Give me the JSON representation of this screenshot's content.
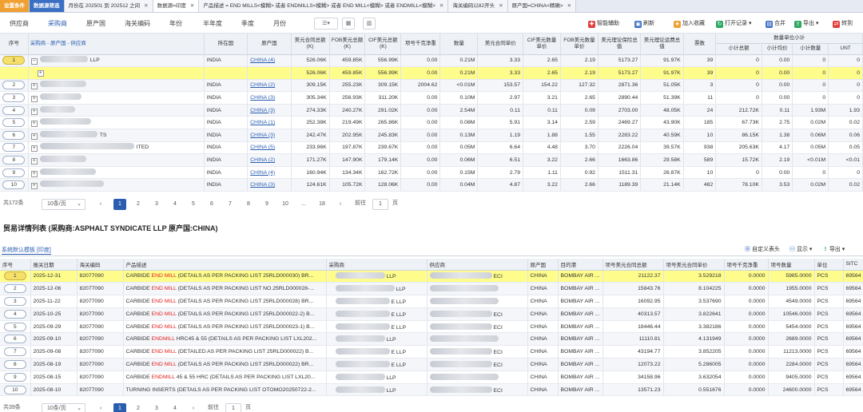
{
  "filter_tabs": [
    {
      "label": "设置条件",
      "style": "orange",
      "closable": false
    },
    {
      "label": "数据源筛选",
      "style": "blue",
      "closable": false
    },
    {
      "label": "月份在 202501 到 202512 之间",
      "style": "",
      "closable": true
    },
    {
      "label": "数据源=印度",
      "style": "active",
      "closable": true
    },
    {
      "label": "产品描述 = END MILLS<模糊> 或者 ENDMILLS<模糊> 或者 END MILL<模糊> 或者 ENDMILL<模糊>",
      "style": "",
      "closable": true
    },
    {
      "label": "海关编码以82开头",
      "style": "",
      "closable": true
    },
    {
      "label": "原产国=CHINA<精确>",
      "style": "",
      "closable": true
    }
  ],
  "dimension_tabs": [
    "供应商",
    "采购商",
    "原产国",
    "海关编码",
    "年份",
    "半年度",
    "季度",
    "月份"
  ],
  "toolbar": {
    "smart_assist": "智能辅助",
    "refresh": "刷新",
    "add_favorite": "加入收藏",
    "open_record": "打开记录",
    "merge": "合并",
    "export": "导出",
    "convert": "转到"
  },
  "summary_table": {
    "headers": {
      "seq": "序号",
      "buyer": "采购商 - 原产国 - 供应商",
      "country": "所在国",
      "origin": "原产国",
      "usd_total": "美元合同总额(K)",
      "fob_total": "FOB美元总额(K)",
      "cif_total": "CIF美元总额(K)",
      "net_weight": "项号千克净重",
      "qty": "数量",
      "usd_unit": "美元合同单价",
      "cif_unit": "CIF美元数量单价",
      "fob_unit": "FOB美元数量单价",
      "theory_unit": "美元理论保险总值",
      "theory_total": "美元理论运费总值",
      "count": "票数",
      "group_unit": "数量单位小计",
      "sub_amount": "小计总额",
      "sub_unit_price": "小计均价",
      "sub_qty": "小计数量",
      "unt": "UNT"
    },
    "rows": [
      {
        "seq": "1",
        "buyer_tail": "LLP",
        "country": "INDIA",
        "origin": "CHINA (4)",
        "usd_total": "526.06K",
        "fob_total": "459.85K",
        "cif_total": "556.99K",
        "net_weight": "0.00",
        "qty": "0.21M",
        "usd_unit": "3.33",
        "cif_unit": "2.65",
        "fob_unit": "2.19",
        "theory_unit": "5173.27",
        "theory_total": "91.97K",
        "count": "39",
        "sub_amount": "0",
        "sub_unit_price": "0.00",
        "sub_qty": "0",
        "unt": "0",
        "type": "parent"
      },
      {
        "seq": "",
        "buyer_tail": "",
        "country": "",
        "origin": "",
        "usd_total": "526.06K",
        "fob_total": "459.85K",
        "cif_total": "556.99K",
        "net_weight": "0.00",
        "qty": "0.21M",
        "usd_unit": "3.33",
        "cif_unit": "2.65",
        "fob_unit": "2.19",
        "theory_unit": "5173.27",
        "theory_total": "91.97K",
        "count": "39",
        "sub_amount": "0",
        "sub_unit_price": "0.00",
        "sub_qty": "0",
        "unt": "0",
        "type": "highlight"
      },
      {
        "seq": "2",
        "buyer_tail": "",
        "country": "INDIA",
        "origin": "CHINA (2)",
        "usd_total": "309.15K",
        "fob_total": "255.23K",
        "cif_total": "309.15K",
        "net_weight": "2004.62",
        "qty": "<0.01M",
        "usd_unit": "153.57",
        "cif_unit": "154.22",
        "fob_unit": "127.32",
        "theory_unit": "2871.36",
        "theory_total": "51.05K",
        "count": "3",
        "sub_amount": "0",
        "sub_unit_price": "0.00",
        "sub_qty": "0",
        "unt": "0",
        "type": "row"
      },
      {
        "seq": "3",
        "buyer_tail": "",
        "country": "INDIA",
        "origin": "CHINA (3)",
        "usd_total": "305.34K",
        "fob_total": "256.93K",
        "cif_total": "311.20K",
        "net_weight": "0.00",
        "qty": "0.10M",
        "usd_unit": "2.97",
        "cif_unit": "3.21",
        "fob_unit": "2.65",
        "theory_unit": "2890.44",
        "theory_total": "51.39K",
        "count": "11",
        "sub_amount": "0",
        "sub_unit_price": "0.00",
        "sub_qty": "0",
        "unt": "0",
        "type": "row"
      },
      {
        "seq": "4",
        "buyer_tail": "",
        "country": "INDIA",
        "origin": "CHINA (3)",
        "usd_total": "274.33K",
        "fob_total": "240.27K",
        "cif_total": "291.02K",
        "net_weight": "0.00",
        "qty": "2.54M",
        "usd_unit": "0.11",
        "cif_unit": "0.11",
        "fob_unit": "0.09",
        "theory_unit": "2703.00",
        "theory_total": "48.05K",
        "count": "24",
        "sub_amount": "212.72K",
        "sub_unit_price": "0.11",
        "sub_qty": "1.93M",
        "unt": "1.93",
        "type": "row"
      },
      {
        "seq": "5",
        "buyer_tail": "",
        "country": "INDIA",
        "origin": "CHINA (1)",
        "usd_total": "252.38K",
        "fob_total": "219.49K",
        "cif_total": "265.86K",
        "net_weight": "0.00",
        "qty": "0.08M",
        "usd_unit": "5.91",
        "cif_unit": "3.14",
        "fob_unit": "2.59",
        "theory_unit": "2469.27",
        "theory_total": "43.90K",
        "count": "185",
        "sub_amount": "67.73K",
        "sub_unit_price": "2.75",
        "sub_qty": "0.02M",
        "unt": "0.02",
        "type": "row"
      },
      {
        "seq": "6",
        "buyer_tail": "TS",
        "country": "INDIA",
        "origin": "CHINA (3)",
        "usd_total": "242.47K",
        "fob_total": "202.95K",
        "cif_total": "245.83K",
        "net_weight": "0.00",
        "qty": "0.13M",
        "usd_unit": "1.19",
        "cif_unit": "1.88",
        "fob_unit": "1.55",
        "theory_unit": "2283.22",
        "theory_total": "40.59K",
        "count": "10",
        "sub_amount": "86.15K",
        "sub_unit_price": "1.38",
        "sub_qty": "0.06M",
        "unt": "0.06",
        "type": "row"
      },
      {
        "seq": "7",
        "buyer_tail": "ITED",
        "country": "INDIA",
        "origin": "CHINA (5)",
        "usd_total": "233.96K",
        "fob_total": "197.87K",
        "cif_total": "239.67K",
        "net_weight": "0.00",
        "qty": "0.05M",
        "usd_unit": "6.64",
        "cif_unit": "4.48",
        "fob_unit": "3.70",
        "theory_unit": "2226.04",
        "theory_total": "39.57K",
        "count": "938",
        "sub_amount": "205.63K",
        "sub_unit_price": "4.17",
        "sub_qty": "0.05M",
        "unt": "0.05",
        "type": "row"
      },
      {
        "seq": "8",
        "buyer_tail": "",
        "country": "INDIA",
        "origin": "CHINA (2)",
        "usd_total": "171.27K",
        "fob_total": "147.90K",
        "cif_total": "179.14K",
        "net_weight": "0.00",
        "qty": "0.06M",
        "usd_unit": "6.51",
        "cif_unit": "3.22",
        "fob_unit": "2.66",
        "theory_unit": "1663.86",
        "theory_total": "29.58K",
        "count": "589",
        "sub_amount": "15.72K",
        "sub_unit_price": "2.19",
        "sub_qty": "<0.01M",
        "unt": "<0.01",
        "type": "row"
      },
      {
        "seq": "9",
        "buyer_tail": "",
        "country": "INDIA",
        "origin": "CHINA (4)",
        "usd_total": "160.94K",
        "fob_total": "134.34K",
        "cif_total": "162.72K",
        "net_weight": "0.00",
        "qty": "0.15M",
        "usd_unit": "2.79",
        "cif_unit": "1.11",
        "fob_unit": "0.92",
        "theory_unit": "1511.31",
        "theory_total": "26.87K",
        "count": "10",
        "sub_amount": "0",
        "sub_unit_price": "0.00",
        "sub_qty": "0",
        "unt": "0",
        "type": "row"
      },
      {
        "seq": "10",
        "buyer_tail": "",
        "country": "INDIA",
        "origin": "CHINA (3)",
        "usd_total": "124.61K",
        "fob_total": "105.72K",
        "cif_total": "128.06K",
        "net_weight": "0.00",
        "qty": "0.04M",
        "usd_unit": "4.87",
        "cif_unit": "3.22",
        "fob_unit": "2.66",
        "theory_unit": "1189.39",
        "theory_total": "21.14K",
        "count": "482",
        "sub_amount": "78.10K",
        "sub_unit_price": "3.53",
        "sub_qty": "0.02M",
        "unt": "0.02",
        "type": "row"
      }
    ]
  },
  "pager_top": {
    "total": "共172条",
    "page_size": "10条/页",
    "pages": [
      "1",
      "2",
      "3",
      "4",
      "5",
      "6",
      "7",
      "8",
      "9",
      "10",
      "...",
      "18"
    ],
    "current": "1",
    "goto_label": "前往",
    "goto_value": "1",
    "page_unit": "页"
  },
  "detail": {
    "title": "贸易详情列表 (采购商:ASPHALT SYNDICATE LLP 原产国:CHINA)",
    "template_label": "系统默认模板 [印度]",
    "custom_header": "自定义表头",
    "display": "显示",
    "export": "导出",
    "headers": {
      "seq": "序号",
      "date": "报关日期",
      "hs": "海关编码",
      "desc": "产品描述",
      "buyer": "采购商",
      "supplier": "供应商",
      "origin": "原产国",
      "dest": "目的港",
      "usd_total": "项号美元合同总额",
      "usd_unit": "项号美元合同单价",
      "net_weight": "项号千克净重",
      "qty": "项号数量",
      "unit": "单位",
      "sitc": "SITC"
    },
    "rows": [
      {
        "seq": "1",
        "date": "2025-12-31",
        "hs": "82077090",
        "desc_pre": "CARBIDE ",
        "desc_hl": "END MILL",
        "desc_post": " (DETAILS AS PER PACKING LIST 25RLD000030) BR...",
        "buyer_tail": "LLP",
        "supplier_tail": "ECI",
        "origin": "CHINA",
        "dest": "BOMBAY AIR ...",
        "usd_total": "21122.37",
        "usd_unit": "3.529218",
        "net_weight": "0.0000",
        "qty": "5985.0000",
        "unit": "PCS",
        "sitc": "69564"
      },
      {
        "seq": "2",
        "date": "2025-12-06",
        "hs": "82077090",
        "desc_pre": "CARBIDE ",
        "desc_hl": "END MILL",
        "desc_post": " (DETAILS AS PER PACKING LIST NO.25RLD000028-...",
        "buyer_tail": "LLP",
        "supplier_tail": "",
        "origin": "CHINA",
        "dest": "BOMBAY AIR ...",
        "usd_total": "15843.76",
        "usd_unit": "8.104225",
        "net_weight": "0.0000",
        "qty": "1955.0000",
        "unit": "PCS",
        "sitc": "69564"
      },
      {
        "seq": "3",
        "date": "2025-11-22",
        "hs": "82077090",
        "desc_pre": "CARBIDE ",
        "desc_hl": "END MILL",
        "desc_post": " (DETAILS AS PER PACKING LIST 25RLD000028) BR...",
        "buyer_tail": "E LLP",
        "supplier_tail": "",
        "origin": "CHINA",
        "dest": "BOMBAY AIR ...",
        "usd_total": "16092.95",
        "usd_unit": "3.537690",
        "net_weight": "0.0000",
        "qty": "4549.0000",
        "unit": "PCS",
        "sitc": "69564"
      },
      {
        "seq": "4",
        "date": "2025-10-25",
        "hs": "82077090",
        "desc_pre": "CARBIDE ",
        "desc_hl": "END MILL",
        "desc_post": " (DETAILS AS PER PACKING LIST 25RLD000022-2) B...",
        "buyer_tail": "E LLP",
        "supplier_tail": "ECI",
        "origin": "CHINA",
        "dest": "BOMBAY AIR ...",
        "usd_total": "40313.57",
        "usd_unit": "3.822641",
        "net_weight": "0.0000",
        "qty": "10546.0000",
        "unit": "PCS",
        "sitc": "69564"
      },
      {
        "seq": "5",
        "date": "2025-09-29",
        "hs": "82077090",
        "desc_pre": "CARBIDE ",
        "desc_hl": "END MILL",
        "desc_post": " (DETAILS AS PER PACKING LIST 25RLD000023-1) B...",
        "buyer_tail": "E LLP",
        "supplier_tail": "ECI",
        "origin": "CHINA",
        "dest": "BOMBAY AIR ...",
        "usd_total": "18446.44",
        "usd_unit": "3.382186",
        "net_weight": "0.0000",
        "qty": "5454.0000",
        "unit": "PCS",
        "sitc": "69564"
      },
      {
        "seq": "6",
        "date": "2025-09-10",
        "hs": "82077090",
        "desc_pre": "CARBIDE ",
        "desc_hl": "ENDMILL",
        "desc_post": " HRC45 & 55 (DETAILS AS PER PACKING LIST LXL202...",
        "buyer_tail": "LLP",
        "supplier_tail": "",
        "origin": "CHINA",
        "dest": "BOMBAY AIR ...",
        "usd_total": "11110.81",
        "usd_unit": "4.131949",
        "net_weight": "0.0000",
        "qty": "2689.0000",
        "unit": "PCS",
        "sitc": "69564"
      },
      {
        "seq": "7",
        "date": "2025-09-08",
        "hs": "82077090",
        "desc_pre": "CARBIDE ",
        "desc_hl": "END MILL",
        "desc_post": " (DETAILED AS PER PACKING LIST 25RLD000022) B...",
        "buyer_tail": "E LLP",
        "supplier_tail": "ECI",
        "origin": "CHINA",
        "dest": "BOMBAY AIR ...",
        "usd_total": "43194.77",
        "usd_unit": "3.852205",
        "net_weight": "0.0000",
        "qty": "11213.0000",
        "unit": "PCS",
        "sitc": "69564"
      },
      {
        "seq": "8",
        "date": "2025-08-19",
        "hs": "82077090",
        "desc_pre": "CARBIDE ",
        "desc_hl": "END MILL",
        "desc_post": " (DETAILS AS PER PACKING LIST 25RLD000022) BR...",
        "buyer_tail": "E LLP",
        "supplier_tail": "ECI",
        "origin": "CHINA",
        "dest": "BOMBAY AIR ...",
        "usd_total": "12073.22",
        "usd_unit": "5.286005",
        "net_weight": "0.0000",
        "qty": "2284.0000",
        "unit": "PCS",
        "sitc": "69564"
      },
      {
        "seq": "9",
        "date": "2025-08-15",
        "hs": "82077090",
        "desc_pre": "CARBIDE ",
        "desc_hl": "ENDMILL",
        "desc_post": " 45 & 55 HRC (DETAILS AS PER PACKING LIST LXL20...",
        "buyer_tail": "LLP",
        "supplier_tail": "",
        "origin": "CHINA",
        "dest": "BOMBAY AIR ...",
        "usd_total": "34158.96",
        "usd_unit": "3.632054",
        "net_weight": "0.0000",
        "qty": "9405.0000",
        "unit": "PCS",
        "sitc": "69564"
      },
      {
        "seq": "10",
        "date": "2025-08-10",
        "hs": "82077090",
        "desc_pre": "TURNING INSERTS (DETAILS AS PER PACKING LIST OTOMO20250722-2...",
        "desc_hl": "",
        "desc_post": "",
        "buyer_tail": "LLP",
        "supplier_tail": "ECI",
        "origin": "CHINA",
        "dest": "BOMBAY AIR ...",
        "usd_total": "13571.23",
        "usd_unit": "0.551676",
        "net_weight": "0.0000",
        "qty": "24600.0000",
        "unit": "PCS",
        "sitc": "69564"
      }
    ]
  },
  "pager_bottom": {
    "total": "共39条",
    "page_size": "10条/页",
    "pages": [
      "1",
      "2",
      "3",
      "4"
    ],
    "current": "1",
    "goto_label": "前往",
    "goto_value": "1",
    "page_unit": "页"
  },
  "colors": {
    "accent": "#2a5db0",
    "highlight": "#fefc8a",
    "keyword": "#e02020",
    "tab_orange": "#f0a030"
  }
}
